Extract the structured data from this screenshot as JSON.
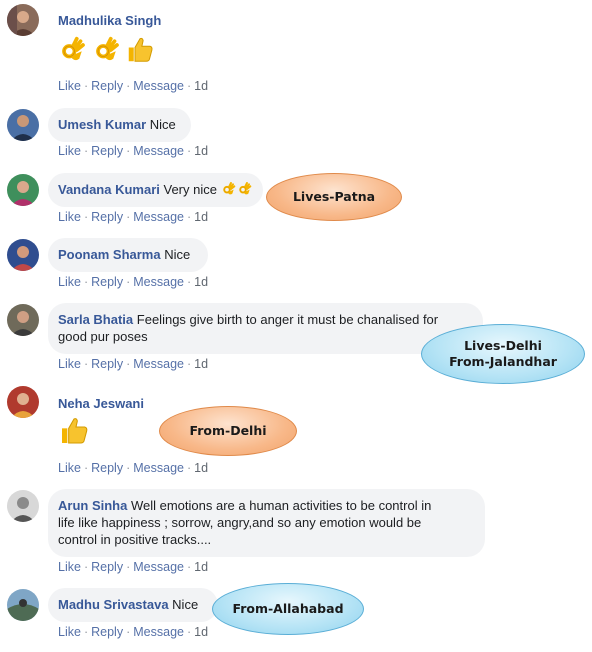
{
  "actions": {
    "like": "Like",
    "reply": "Reply",
    "message": "Message",
    "separator": "·"
  },
  "comments": [
    {
      "name": "Madhulika Singh",
      "text": "",
      "time": "1d",
      "emoji": [
        "ok-hand",
        "ok-hand",
        "thumbs-up"
      ]
    },
    {
      "name": "Umesh Kumar",
      "text": "Nice",
      "time": "1d"
    },
    {
      "name": "Vandana Kumari",
      "text": "Very nice",
      "time": "1d",
      "emoji": [
        "ok-hand",
        "ok-hand"
      ]
    },
    {
      "name": "Poonam Sharma",
      "text": "Nice",
      "time": "1d"
    },
    {
      "name": "Sarla Bhatia",
      "text": "Feelings give birth to anger it must be chanalised for",
      "text2": "good pur poses",
      "time": "1d"
    },
    {
      "name": "Neha Jeswani",
      "text": "",
      "time": "1d",
      "emoji": [
        "thumbs-up"
      ]
    },
    {
      "name": "Arun Sinha",
      "text": "Well emotions are a human activities to be control in",
      "text2": "life like happiness ; sorrow, angry,and so any emotion would be",
      "text3": "control in positive tracks....",
      "time": "1d"
    },
    {
      "name": "Madhu Srivastava",
      "text": "Nice",
      "time": "1d"
    }
  ],
  "annotations": {
    "vandana": "Lives-Patna",
    "sarla_line1": "Lives-Delhi",
    "sarla_line2": "From-Jalandhar",
    "neha": "From-Delhi",
    "madhu": "From-Allahabad"
  },
  "colors": {
    "name": "#385898",
    "bubble": "#f2f3f5",
    "meta": "#606770",
    "orange_badge": "#f8b889",
    "blue_badge": "#b4e3f5"
  }
}
